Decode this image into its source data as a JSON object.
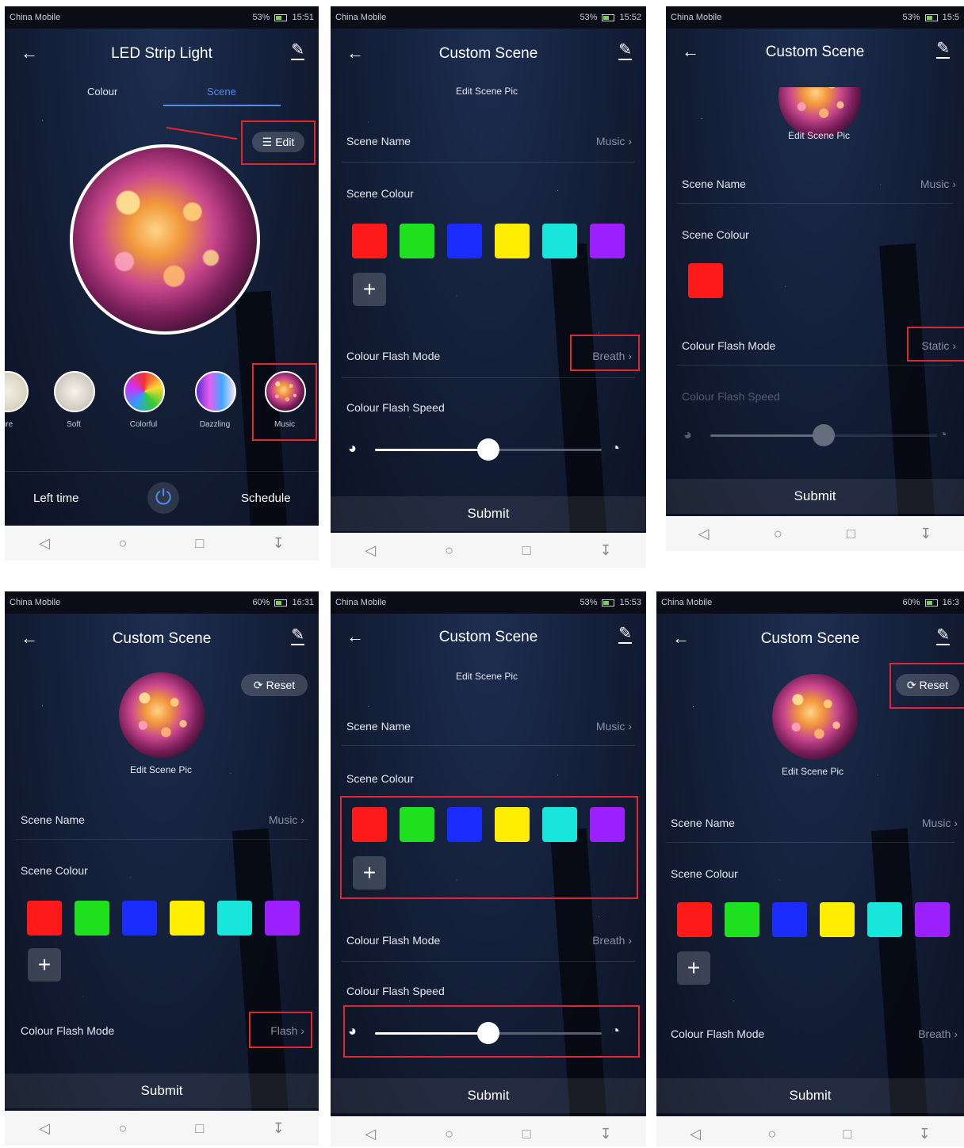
{
  "status": {
    "p1": {
      "carrier": "China Mobile",
      "battery": "53%",
      "time": "15:51"
    },
    "p2": {
      "carrier": "China Mobile",
      "battery": "53%",
      "time": "15:52"
    },
    "p3": {
      "carrier": "China Mobile",
      "battery": "53%",
      "time": "15:5"
    },
    "p4": {
      "carrier": "China Mobile",
      "battery": "60%",
      "time": "16:31"
    },
    "p5": {
      "carrier": "China Mobile",
      "battery": "53%",
      "time": "15:53"
    },
    "p6": {
      "carrier": "China Mobile",
      "battery": "60%",
      "time": "16:3"
    }
  },
  "titles": {
    "led": "LED Strip Light",
    "custom": "Custom Scene"
  },
  "tabs": {
    "colour": "Colour",
    "scene": "Scene"
  },
  "labels": {
    "edit": "Edit",
    "edit_scene_pic": "Edit Scene Pic",
    "scene_name": "Scene Name",
    "scene_colour": "Scene Colour",
    "colour_flash_mode": "Colour Flash Mode",
    "colour_flash_speed": "Colour Flash Speed",
    "submit": "Submit",
    "reset": "Reset",
    "left_time": "Left time",
    "schedule": "Schedule"
  },
  "values": {
    "scene_name": "Music",
    "mode_p2": "Breath",
    "mode_p3": "Static",
    "mode_p4": "Flash",
    "mode_p5": "Breath",
    "mode_p6": "Breath"
  },
  "scenes": [
    {
      "label": "ure"
    },
    {
      "label": "Soft"
    },
    {
      "label": "Colorful"
    },
    {
      "label": "Dazzling"
    },
    {
      "label": "Music"
    }
  ],
  "colours": [
    "#ff1a1a",
    "#1fe01f",
    "#1a2cff",
    "#ffee00",
    "#18e6da",
    "#9b1fff"
  ],
  "single_colour": "#ff1a1a",
  "speed_level": 0.5,
  "icons": {
    "back": "arrow-left-icon",
    "edit": "pencil-icon",
    "add": "plus-icon",
    "power": "power-icon",
    "reset": "refresh-icon",
    "slow": "speedometer-slow-icon",
    "fast": "speedometer-fast-icon",
    "nav": [
      "triangle-back-icon",
      "circle-home-icon",
      "square-recent-icon",
      "menu-down-icon"
    ]
  }
}
